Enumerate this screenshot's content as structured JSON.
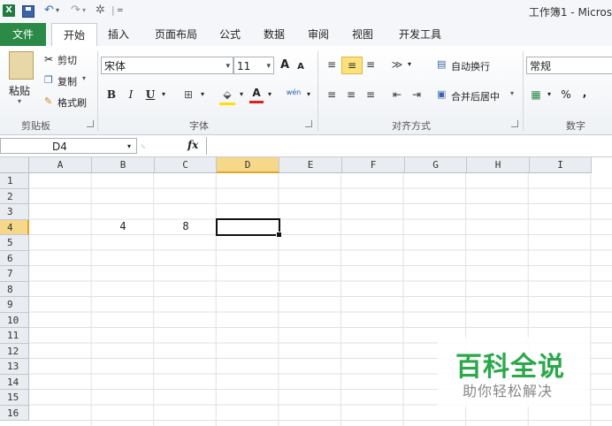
{
  "window": {
    "app_icon": "X",
    "title": "工作簿1 - Micros"
  },
  "tabs": [
    {
      "label": "文件"
    },
    {
      "label": "开始"
    },
    {
      "label": "插入"
    },
    {
      "label": "页面布局"
    },
    {
      "label": "公式"
    },
    {
      "label": "数据"
    },
    {
      "label": "审阅"
    },
    {
      "label": "视图"
    },
    {
      "label": "开发工具"
    }
  ],
  "clipboard": {
    "paste": "粘贴",
    "cut": "剪切",
    "copy": "复制",
    "format_painter": "格式刷",
    "group": "剪贴板"
  },
  "font": {
    "name": "宋体",
    "size": "11",
    "grow": "A",
    "shrink": "A",
    "bold": "B",
    "italic": "I",
    "underline": "U",
    "color_letter": "A",
    "phonetic": "wén",
    "group": "字体"
  },
  "alignment": {
    "wrap_text": "自动换行",
    "merge_center": "合并后居中",
    "group": "对齐方式"
  },
  "number": {
    "format": "常规",
    "percent": "%",
    "comma": ",",
    "group": "数字"
  },
  "formula_bar": {
    "name_box": "D4",
    "fx": "fx"
  },
  "sheet": {
    "columns": [
      "A",
      "B",
      "C",
      "D",
      "E",
      "F",
      "G",
      "H",
      "I"
    ],
    "rows": [
      "1",
      "2",
      "3",
      "4",
      "5",
      "6",
      "7",
      "8",
      "9",
      "10",
      "11",
      "12",
      "13",
      "14",
      "15",
      "16"
    ],
    "cells": {
      "B4": "4",
      "C4": "8"
    },
    "active_cell": "D4"
  },
  "watermark": {
    "title": "百科全说",
    "subtitle": "助你轻松解决"
  },
  "colors": {
    "file_tab": "#2a8a46",
    "selection_header": "#f6d88a",
    "watermark": "#2aa84a"
  }
}
